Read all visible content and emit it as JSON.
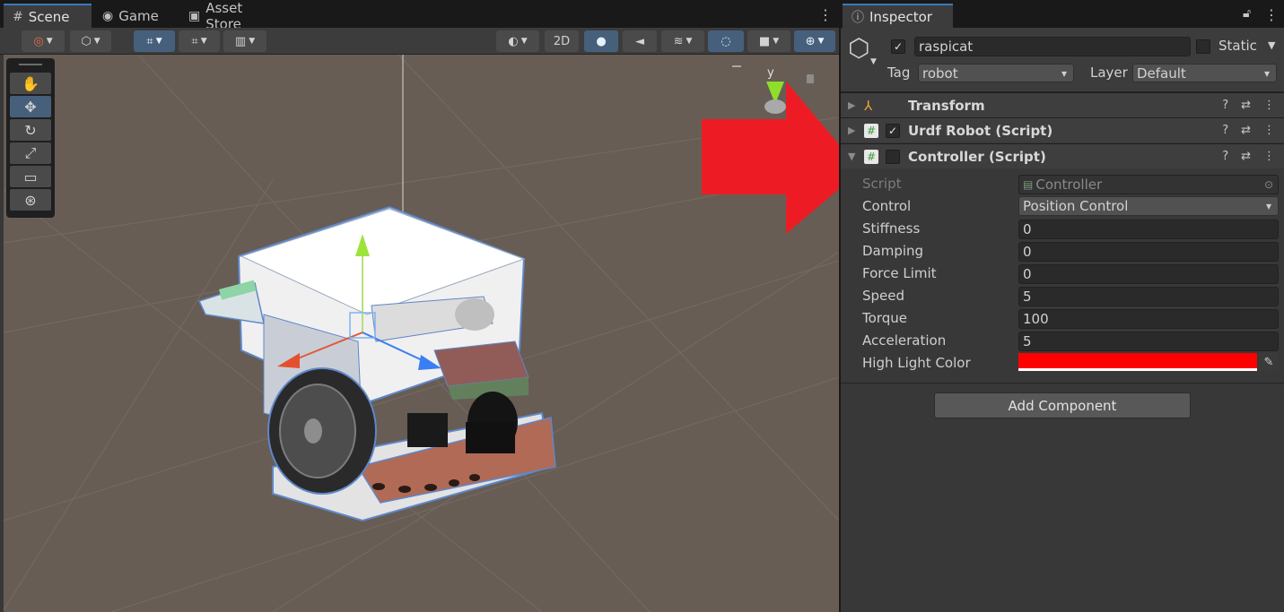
{
  "scene": {
    "tabs": [
      {
        "label": "Scene",
        "icon": "grid-icon"
      },
      {
        "label": "Game",
        "icon": "gamepad-icon"
      },
      {
        "label": "Asset Store",
        "icon": "bag-icon"
      }
    ],
    "toolbar": {
      "mode_2d": "2D"
    },
    "gizmo_axis_label": "y",
    "tools": [
      "hand-tool",
      "move-tool",
      "rotate-tool",
      "scale-tool",
      "rect-tool",
      "transform-tool"
    ]
  },
  "inspector": {
    "tab_label": "Inspector",
    "object": {
      "active": true,
      "name": "raspicat",
      "static_label": "Static",
      "static_checked": false,
      "tag_label": "Tag",
      "tag_value": "robot",
      "layer_label": "Layer",
      "layer_value": "Default"
    },
    "components": [
      {
        "title": "Transform",
        "icon": "transform-icon"
      },
      {
        "title": "Urdf Robot (Script)",
        "icon": "script-icon",
        "enabled": true
      },
      {
        "title": "Controller (Script)",
        "icon": "script-icon",
        "enabled": false
      }
    ],
    "controller_fields": {
      "script_label": "Script",
      "script_value": "Controller",
      "control_label": "Control",
      "control_value": "Position Control",
      "stiffness_label": "Stiffness",
      "stiffness_value": "0",
      "damping_label": "Damping",
      "damping_value": "0",
      "force_limit_label": "Force Limit",
      "force_limit_value": "0",
      "speed_label": "Speed",
      "speed_value": "5",
      "torque_label": "Torque",
      "torque_value": "100",
      "acceleration_label": "Acceleration",
      "acceleration_value": "5",
      "highlight_label": "High Light Color",
      "highlight_color": "#ff0000"
    },
    "add_component_label": "Add Component"
  },
  "annotation": {
    "arrow_color": "#ed1c24"
  }
}
